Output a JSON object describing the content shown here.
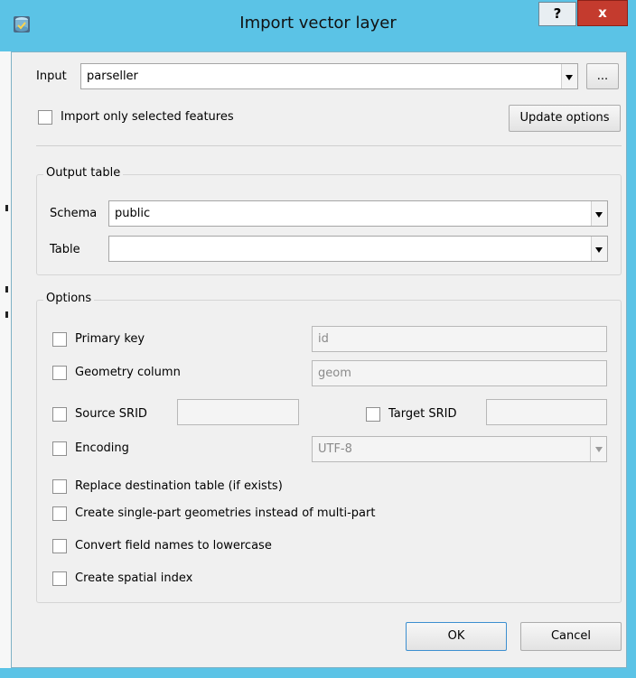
{
  "window": {
    "title": "Import vector layer",
    "help_label": "?",
    "close_label": "x"
  },
  "input": {
    "label": "Input",
    "value": "parseller",
    "browse_label": "..."
  },
  "import_only_selected_label": "Import only selected features",
  "update_options_label": "Update options",
  "output_table": {
    "title": "Output table",
    "schema_label": "Schema",
    "schema_value": "public",
    "table_label": "Table",
    "table_value": ""
  },
  "options": {
    "title": "Options",
    "primary_key_label": "Primary key",
    "primary_key_value": "id",
    "geometry_column_label": "Geometry column",
    "geometry_column_value": "geom",
    "source_srid_label": "Source SRID",
    "target_srid_label": "Target SRID",
    "encoding_label": "Encoding",
    "encoding_value": "UTF-8",
    "replace_label": "Replace destination table (if exists)",
    "single_part_label": "Create single-part geometries instead of multi-part",
    "lowercase_label": "Convert field names to lowercase",
    "spatial_index_label": "Create spatial index"
  },
  "buttons": {
    "ok": "OK",
    "cancel": "Cancel"
  },
  "colors": {
    "frame": "#5bc3e6",
    "close": "#c43b2e",
    "dialog_bg": "#f0f0f0"
  }
}
